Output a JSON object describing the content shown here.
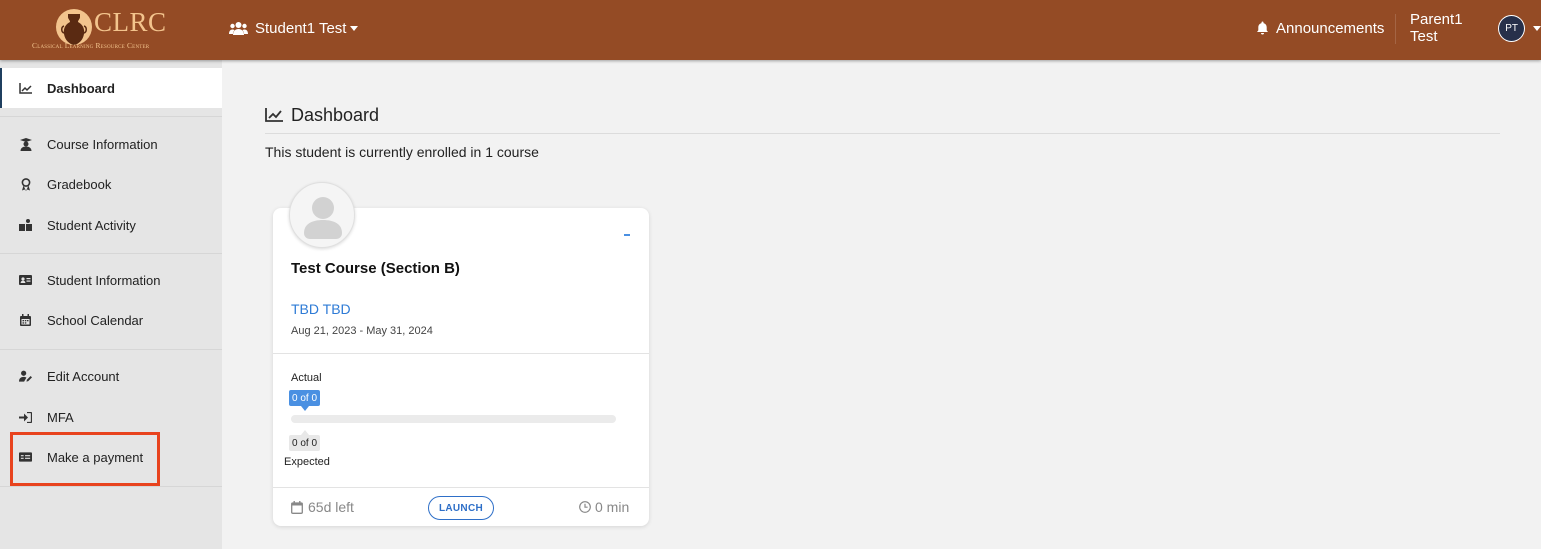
{
  "brand": {
    "logo_text": "CLRC",
    "logo_subtitle": "Classical Learning Resource Center",
    "accent_color": "#944b25",
    "logo_color": "#f3c48d"
  },
  "topbar": {
    "student_selector": {
      "label": "Student1 Test",
      "icon": "users-icon"
    },
    "announcements": {
      "label": "Announcements",
      "icon": "bell-icon"
    },
    "user": {
      "name": "Parent1 Test",
      "initials": "PT"
    }
  },
  "sidebar": {
    "items": [
      {
        "label": "Dashboard",
        "icon": "chart-line-icon",
        "active": true
      },
      {
        "label": "Course Information",
        "icon": "graduate-icon"
      },
      {
        "label": "Gradebook",
        "icon": "award-icon"
      },
      {
        "label": "Student Activity",
        "icon": "activity-icon"
      },
      {
        "label": "Student Information",
        "icon": "id-card-icon"
      },
      {
        "label": "School Calendar",
        "icon": "calendar-icon"
      },
      {
        "label": "Edit Account",
        "icon": "user-edit-icon"
      },
      {
        "label": "MFA",
        "icon": "sign-in-icon"
      },
      {
        "label": "Make a payment",
        "icon": "money-check-icon",
        "highlighted": true
      }
    ]
  },
  "main": {
    "heading": "Dashboard",
    "enrollment_text": "This student is currently enrolled in 1 course",
    "course_card": {
      "title": "Test Course (Section B)",
      "teacher": "TBD TBD",
      "dates": "Aug 21, 2023 - May 31, 2024",
      "actual_label": "Actual",
      "actual_value": "0 of 0",
      "actual_progress_fraction": 0,
      "expected_value": "0 of 0",
      "expected_label": "Expected",
      "days_left": "65d left",
      "launch_label": "LAUNCH",
      "time_spent": "0 min"
    }
  }
}
